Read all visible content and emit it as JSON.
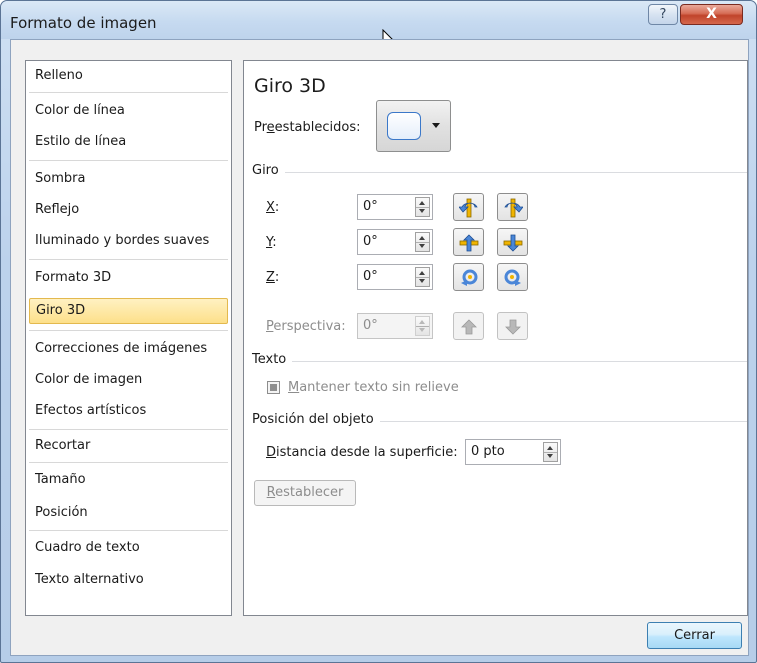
{
  "window": {
    "title": "Formato de imagen",
    "help_label": "?",
    "close_label": "X"
  },
  "sidebar": {
    "items": [
      {
        "label": "Relleno"
      },
      {
        "label": "Color de línea"
      },
      {
        "label": "Estilo de línea"
      },
      {
        "label": "Sombra"
      },
      {
        "label": "Reflejo"
      },
      {
        "label": "Iluminado y bordes suaves"
      },
      {
        "label": "Formato 3D"
      },
      {
        "label": "Giro 3D",
        "selected": true
      },
      {
        "label": "Correcciones de imágenes"
      },
      {
        "label": "Color de imagen"
      },
      {
        "label": "Efectos artísticos"
      },
      {
        "label": "Recortar"
      },
      {
        "label": "Tamaño"
      },
      {
        "label": "Posición"
      },
      {
        "label": "Cuadro de texto"
      },
      {
        "label": "Texto alternativo"
      }
    ]
  },
  "panel": {
    "title": "Giro 3D",
    "presets": {
      "pre": "Pr",
      "key": "e",
      "post": "establecidos:"
    },
    "rotation_section": "Giro",
    "x": {
      "key": "X",
      "suffix": ":",
      "value": "0°"
    },
    "y": {
      "key": "Y",
      "suffix": ":",
      "value": "0°"
    },
    "z": {
      "key": "Z",
      "suffix": ":",
      "value": "0°"
    },
    "perspective": {
      "key": "P",
      "suffix": "erspectiva:",
      "value": "0°",
      "disabled": true
    },
    "text_section": "Texto",
    "keep_flat": {
      "key": "M",
      "suffix": "antener texto sin relieve",
      "checked": false,
      "disabled": true
    },
    "object_position_section": "Posición del objeto",
    "distance": {
      "key": "D",
      "suffix": "istancia desde la superficie:",
      "value": "0 pto"
    },
    "reset": {
      "key": "R",
      "suffix": "establecer",
      "disabled": true
    }
  },
  "footer": {
    "close_label": "Cerrar"
  },
  "colors": {
    "accent": "#3b78c9",
    "selected_bg": "#fde08a",
    "close_red": "#c0442b",
    "disabled_text": "#8d8d8d"
  },
  "icons": {
    "x_left": "rotate-x-left-icon",
    "x_right": "rotate-x-right-icon",
    "y_up": "rotate-y-up-icon",
    "y_down": "rotate-y-down-icon",
    "z_ccw": "rotate-z-counterclockwise-icon",
    "z_cw": "rotate-z-clockwise-icon",
    "persp_increase": "perspective-increase-icon",
    "persp_decrease": "perspective-decrease-icon"
  }
}
